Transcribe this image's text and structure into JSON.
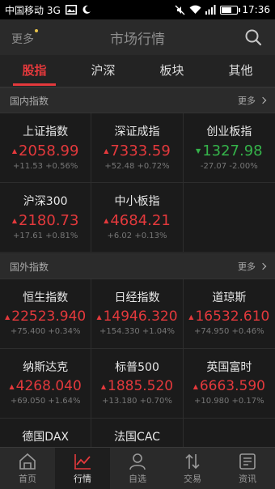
{
  "status_bar": {
    "carrier": "中国移动 3G",
    "time": "17:36"
  },
  "header": {
    "more_label": "更多",
    "title": "市场行情"
  },
  "tabs": [
    {
      "label": "股指"
    },
    {
      "label": "沪深"
    },
    {
      "label": "板块"
    },
    {
      "label": "其他"
    }
  ],
  "domestic": {
    "title": "国内指数",
    "more_label": "更多",
    "items": [
      {
        "name": "上证指数",
        "value": "2058.99",
        "change": "+11.53  +0.56%",
        "direction": "up"
      },
      {
        "name": "深证成指",
        "value": "7333.59",
        "change": "+52.48  +0.72%",
        "direction": "up"
      },
      {
        "name": "创业板指",
        "value": "1327.98",
        "change": "-27.07  -2.00%",
        "direction": "down"
      },
      {
        "name": "沪深300",
        "value": "2180.73",
        "change": "+17.61  +0.81%",
        "direction": "up"
      },
      {
        "name": "中小板指",
        "value": "4684.21",
        "change": "+6.02  +0.13%",
        "direction": "up"
      }
    ]
  },
  "foreign": {
    "title": "国外指数",
    "more_label": "更多",
    "items": [
      {
        "name": "恒生指数",
        "value": "22523.940",
        "change": "+75.400  +0.34%",
        "direction": "up"
      },
      {
        "name": "日经指数",
        "value": "14946.320",
        "change": "+154.330  +1.04%",
        "direction": "up"
      },
      {
        "name": "道琼斯",
        "value": "16532.610",
        "change": "+74.950  +0.46%",
        "direction": "up"
      },
      {
        "name": "纳斯达克",
        "value": "4268.040",
        "change": "+69.050  +1.64%",
        "direction": "up"
      },
      {
        "name": "标普500",
        "value": "1885.520",
        "change": "+13.180  +0.70%",
        "direction": "up"
      },
      {
        "name": "英国富时",
        "value": "6663.590",
        "change": "+10.980  +0.17%",
        "direction": "up"
      },
      {
        "name": "德国DAX",
        "value": "",
        "change": "",
        "direction": "up"
      },
      {
        "name": "法国CAC",
        "value": "",
        "change": "",
        "direction": "up"
      }
    ]
  },
  "bottom_nav": [
    {
      "label": "首页",
      "icon": "home-icon"
    },
    {
      "label": "行情",
      "icon": "chart-icon"
    },
    {
      "label": "自选",
      "icon": "user-icon"
    },
    {
      "label": "交易",
      "icon": "transfer-icon"
    },
    {
      "label": "资讯",
      "icon": "news-icon"
    }
  ],
  "colors": {
    "up": "#e4393c",
    "down": "#35b34a",
    "accent": "#e4393c"
  }
}
